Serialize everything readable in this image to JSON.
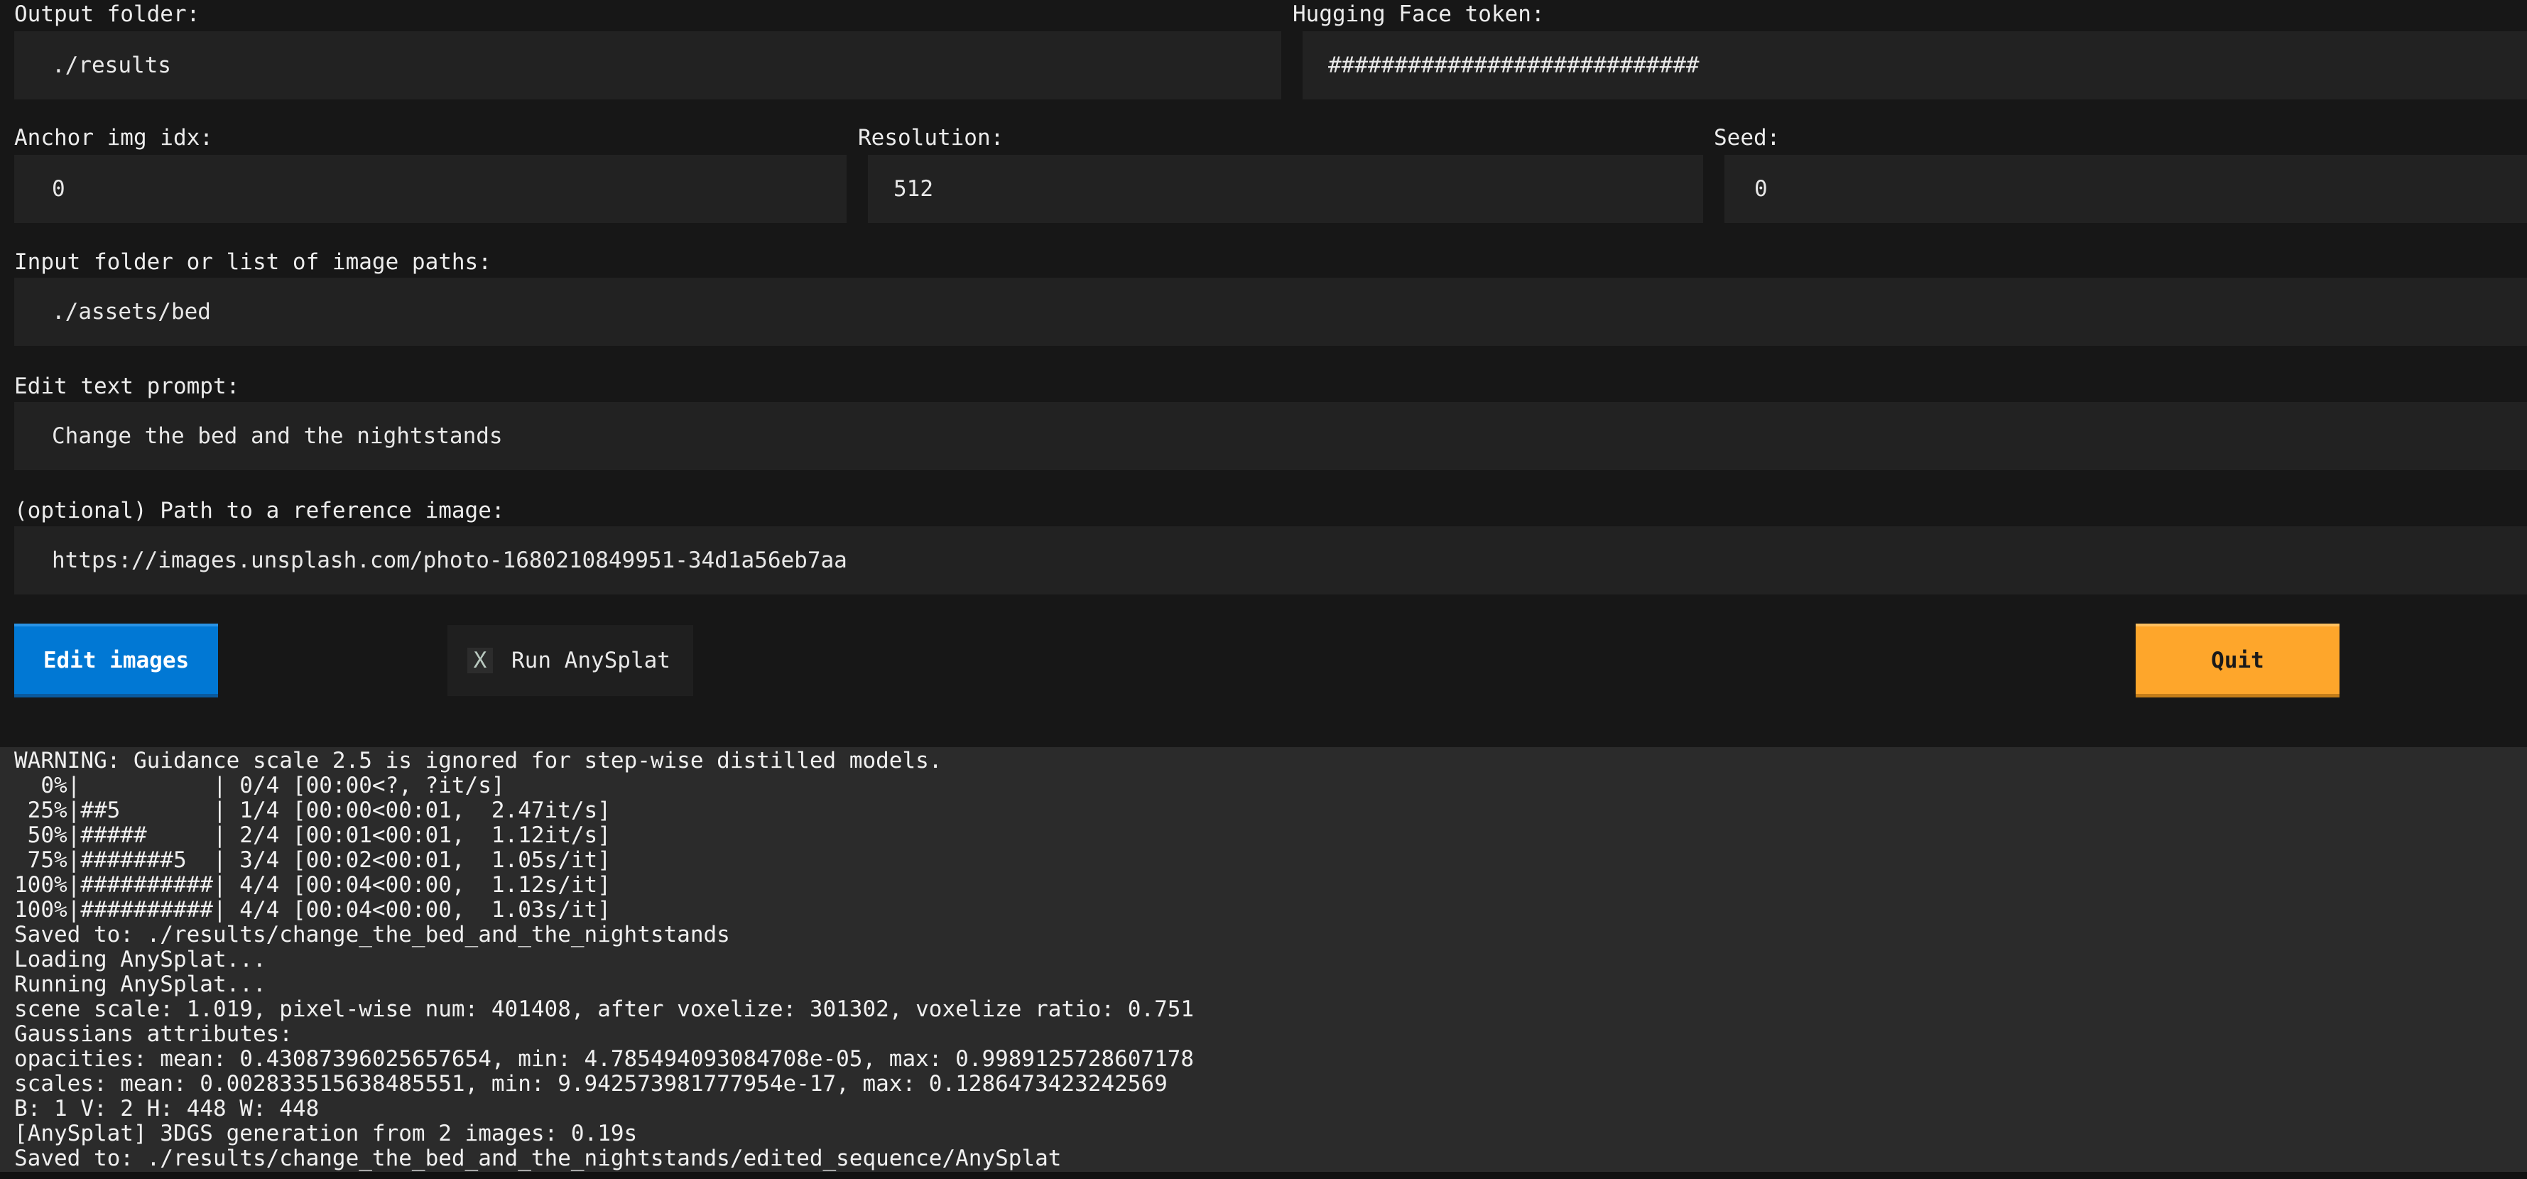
{
  "output_folder": {
    "label": "Output folder:",
    "value": "./results"
  },
  "hf_token": {
    "label": "Hugging Face token:",
    "value": "############################"
  },
  "anchor": {
    "label": "Anchor img idx:",
    "value": "0"
  },
  "resolution": {
    "label": "Resolution:",
    "value": "512"
  },
  "seed": {
    "label": "Seed:",
    "value": "0"
  },
  "input_folder": {
    "label": "Input folder or list of image paths:",
    "value": "./assets/bed"
  },
  "edit_prompt": {
    "label": "Edit text prompt:",
    "value": "Change the bed and the nightstands"
  },
  "reference": {
    "label": "(optional) Path to a reference image:",
    "value": "https://images.unsplash.com/photo-1680210849951-34d1a56eb7aa"
  },
  "buttons": {
    "edit_label": "Edit images",
    "run_anysplat_mark": "X",
    "run_anysplat_label": "Run AnySplat",
    "quit_label": "Quit"
  },
  "colors": {
    "primary": "#0178d4",
    "warning": "#fea62b",
    "background": "#171717",
    "input": "#222222",
    "log": "#2b2b2b"
  },
  "log_lines": [
    "WARNING: Guidance scale 2.5 is ignored for step-wise distilled models.",
    "  0%|          | 0/4 [00:00<?, ?it/s]",
    " 25%|##5       | 1/4 [00:00<00:01,  2.47it/s]",
    " 50%|#####     | 2/4 [00:01<00:01,  1.12it/s]",
    " 75%|#######5  | 3/4 [00:02<00:01,  1.05s/it]",
    "100%|##########| 4/4 [00:04<00:00,  1.12s/it]",
    "100%|##########| 4/4 [00:04<00:00,  1.03s/it]",
    "Saved to: ./results/change_the_bed_and_the_nightstands",
    "Loading AnySplat...",
    "Running AnySplat...",
    "scene scale: 1.019, pixel-wise num: 401408, after voxelize: 301302, voxelize ratio: 0.751",
    "Gaussians attributes:",
    "opacities: mean: 0.43087396025657654, min: 4.785494093084708e-05, max: 0.9989125728607178",
    "scales: mean: 0.002833515638485551, min: 9.942573981777954e-17, max: 0.1286473423242569",
    "B: 1 V: 2 H: 448 W: 448",
    "[AnySplat] 3DGS generation from 2 images: 0.19s",
    "Saved to: ./results/change_the_bed_and_the_nightstands/edited_sequence/AnySplat"
  ]
}
